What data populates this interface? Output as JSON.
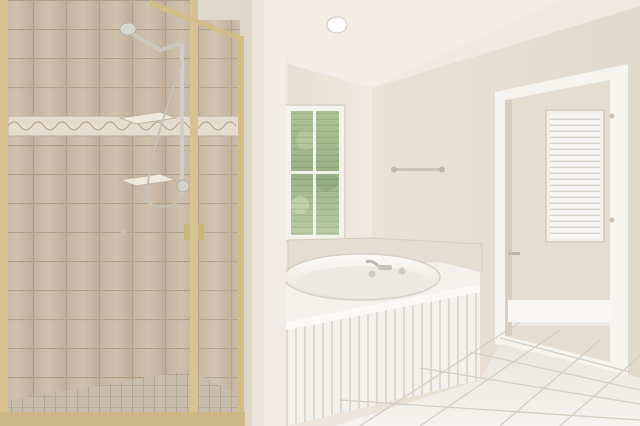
{
  "scene": {
    "alt": "",
    "palette": {
      "wall": "#ece5d9",
      "wall_shadow": "#ddd5c7",
      "ceiling": "#f3efe8",
      "tile": "#c9b9a6",
      "tile_grout": "#b3a38f",
      "floor_tile": "#f0ede7",
      "floor_grout": "#d6d0c6",
      "brass_frame": "#d2bf8c",
      "glass_tint": "#b8a896",
      "tub": "#f4f2ec",
      "foliage": "#5d8a3e",
      "blind": "#f6f4f0",
      "door_trim": "#f7f5f1"
    },
    "objects": [
      "glass-shower-enclosure",
      "handheld-shower-head",
      "corner-shelves",
      "window-with-blinds",
      "garden-tub",
      "wainscot-tub-panel",
      "towel-bar",
      "robe-hook",
      "recessed-ceiling-light",
      "doorway-to-closet",
      "tiled-floor"
    ]
  }
}
